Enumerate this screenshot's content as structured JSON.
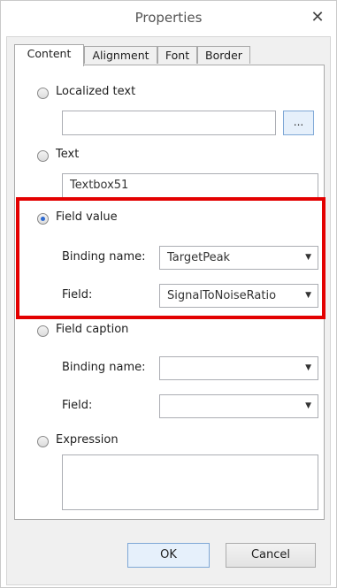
{
  "window": {
    "title": "Properties",
    "close_glyph": "✕"
  },
  "tabs": [
    {
      "label": "Content",
      "active": true
    },
    {
      "label": "Alignment",
      "active": false
    },
    {
      "label": "Font",
      "active": false
    },
    {
      "label": "Border",
      "active": false
    }
  ],
  "options": {
    "localized_text": {
      "label": "Localized text",
      "value": "",
      "button_label": "...",
      "selected": false
    },
    "text": {
      "label": "Text",
      "value": "Textbox51",
      "selected": false
    },
    "field_value": {
      "label": "Field value",
      "selected": true,
      "binding_label": "Binding name:",
      "binding_value": "TargetPeak",
      "field_label": "Field:",
      "field_value": "SignalToNoiseRatio"
    },
    "field_caption": {
      "label": "Field caption",
      "selected": false,
      "binding_label": "Binding name:",
      "binding_value": "",
      "field_label": "Field:",
      "field_value": ""
    },
    "expression": {
      "label": "Expression",
      "value": "",
      "selected": false
    }
  },
  "buttons": {
    "ok": "OK",
    "cancel": "Cancel"
  },
  "icons": {
    "dropdown_arrow": "▼"
  },
  "colors": {
    "highlight": "#e30000",
    "accent": "#2e6ad0"
  }
}
